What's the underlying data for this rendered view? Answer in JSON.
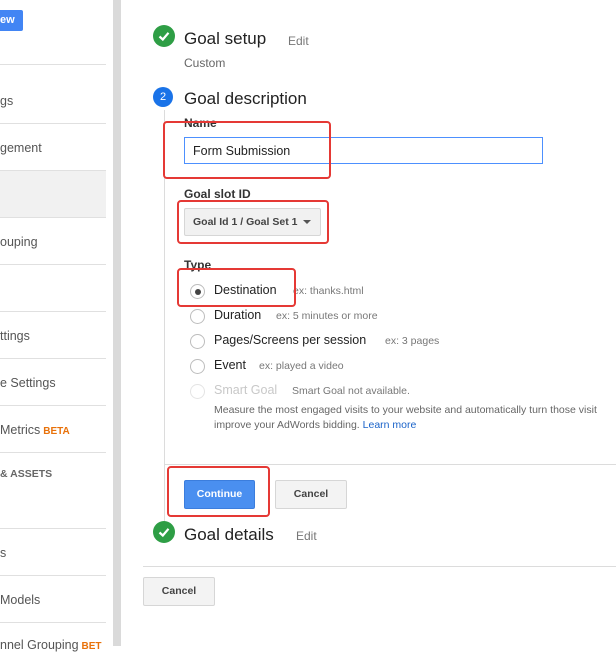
{
  "sidebar": {
    "new_label": "ew",
    "items": [
      {
        "label": "gs"
      },
      {
        "label": "gement"
      },
      {
        "label": ""
      },
      {
        "label": "ouping"
      },
      {
        "label": ""
      },
      {
        "label": "ttings"
      },
      {
        "label": "e Settings"
      },
      {
        "label": "Metrics",
        "badge": "BETA"
      },
      {
        "label": "& ASSETS"
      },
      {
        "label": ""
      },
      {
        "label": "s"
      },
      {
        "label": "Models"
      },
      {
        "label": "nnel Grouping",
        "badge": "BET"
      }
    ]
  },
  "goal_setup": {
    "title": "Goal setup",
    "edit": "Edit",
    "value": "Custom"
  },
  "goal_description": {
    "step_number": "2",
    "title": "Goal description",
    "name_label": "Name",
    "name_value": "Form Submission",
    "slot_label": "Goal slot ID",
    "slot_value": "Goal Id 1 / Goal Set 1",
    "type_label": "Type",
    "types": [
      {
        "label": "Destination",
        "example": "ex: thanks.html",
        "checked": true
      },
      {
        "label": "Duration",
        "example": "ex: 5 minutes or more"
      },
      {
        "label": "Pages/Screens per session",
        "example": "ex: 3 pages"
      },
      {
        "label": "Event",
        "example": "ex: played a video"
      },
      {
        "label": "Smart Goal",
        "example": "Smart Goal not available.",
        "disabled": true
      }
    ],
    "smart_desc_line1": "Measure the most engaged visits to your website and automatically turn those visit",
    "smart_desc_line2": "improve your AdWords bidding.",
    "learn_more": "Learn more",
    "continue": "Continue",
    "cancel": "Cancel"
  },
  "goal_details": {
    "title": "Goal details",
    "edit": "Edit"
  },
  "footer": {
    "cancel": "Cancel"
  },
  "colors": {
    "accent": "#4285f4",
    "success": "#2e9e45",
    "highlight": "#e53935"
  }
}
